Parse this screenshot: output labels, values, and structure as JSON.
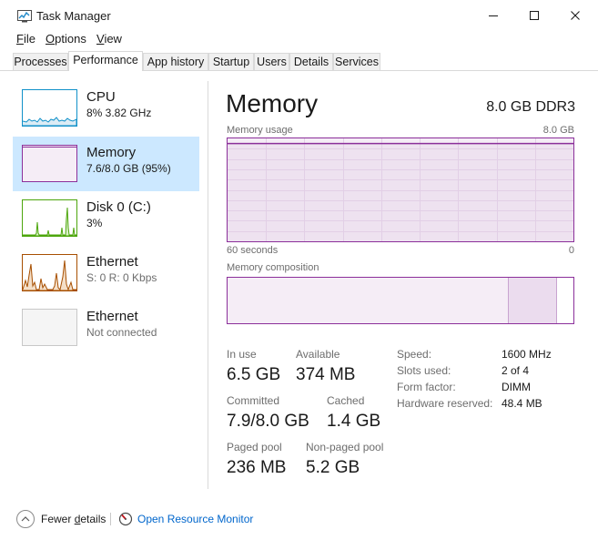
{
  "window": {
    "title": "Task Manager",
    "icon": "task-manager-icon"
  },
  "menu": {
    "file_acc": "F",
    "file_rest": "ile",
    "options_acc": "O",
    "options_rest": "ptions",
    "view_acc": "V",
    "view_rest": "iew"
  },
  "tabs": [
    {
      "label": "Processes"
    },
    {
      "label": "Performance"
    },
    {
      "label": "App history"
    },
    {
      "label": "Startup"
    },
    {
      "label": "Users"
    },
    {
      "label": "Details"
    },
    {
      "label": "Services"
    }
  ],
  "resources": [
    {
      "name": "CPU",
      "sub": "8%  3.82 GHz",
      "color": "#1191c9"
    },
    {
      "name": "Memory",
      "sub": "7.6/8.0 GB (95%)",
      "color": "#8b2f9a"
    },
    {
      "name": "Disk 0 (C:)",
      "sub": "3%",
      "color": "#4da60c"
    },
    {
      "name": "Ethernet",
      "sub": "S: 0  R: 0 Kbps",
      "color": "#a74f01"
    },
    {
      "name": "Ethernet",
      "sub": "Not connected",
      "color": "#c8c8c8"
    }
  ],
  "memory": {
    "heading": "Memory",
    "total": "8.0 GB DDR3",
    "usage_label": "Memory usage",
    "usage_max": "8.0 GB",
    "time_left": "60 seconds",
    "time_right": "0",
    "composition_label": "Memory composition",
    "usage_fraction": 0.95,
    "composition": {
      "in_use_fraction": 0.8125,
      "standby_fraction": 0.14,
      "free_fraction": 0.0475
    },
    "stats": {
      "in_use_label": "In use",
      "in_use": "6.5 GB",
      "available_label": "Available",
      "available": "374 MB",
      "committed_label": "Committed",
      "committed": "7.9/8.0 GB",
      "cached_label": "Cached",
      "cached": "1.4 GB",
      "paged_label": "Paged pool",
      "paged": "236 MB",
      "nonpaged_label": "Non-paged pool",
      "nonpaged": "5.2 GB"
    },
    "specs": {
      "speed_label": "Speed:",
      "speed": "1600 MHz",
      "slots_label": "Slots used:",
      "slots": "2 of 4",
      "form_label": "Form factor:",
      "form": "DIMM",
      "reserved_label": "Hardware reserved:",
      "reserved": "48.4 MB"
    }
  },
  "footer": {
    "fewer_pre": "Fewer ",
    "fewer_acc": "d",
    "fewer_post": "etails",
    "resmon": "Open Resource Monitor"
  },
  "colors": {
    "memory_accent": "#8b2f9a",
    "selected_bg": "#cce8ff",
    "link": "#0066cc"
  }
}
